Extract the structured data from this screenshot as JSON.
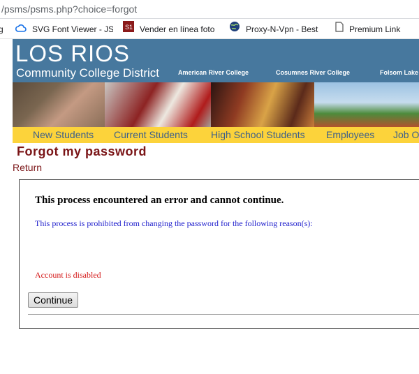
{
  "browser": {
    "url": "/psms/psms.php?choice=forgot",
    "bookmarks": [
      {
        "icon": "cloud-icon",
        "label": "SVG Font Viewer - JS"
      },
      {
        "icon": "st-logo-icon",
        "label": "Vender en línea foto"
      },
      {
        "icon": "globe-icon",
        "label": "Proxy-N-Vpn - Best"
      },
      {
        "icon": "page-icon",
        "label": "Premium Link"
      }
    ],
    "bookmark_prefix": "g"
  },
  "header": {
    "logo_line1": "LOS RIOS",
    "logo_line2": "Community College District",
    "colleges": [
      "American River College",
      "Cosumnes River College",
      "Folsom Lake"
    ]
  },
  "nav": {
    "items": [
      "New Students",
      "Current Students",
      "High School Students",
      "Employees",
      "Job O"
    ]
  },
  "page": {
    "title": "Forgot my password",
    "return_label": "Return"
  },
  "error": {
    "heading": "This process encountered an error and cannot continue.",
    "reason": "This process is prohibited from changing the password for the following reason(s):",
    "cause": "Account is disabled",
    "continue_label": "Continue"
  },
  "colors": {
    "banner": "#47789e",
    "nav": "#fcd33b",
    "title": "#7a1416",
    "reason": "#1d1dcc",
    "cause": "#d41818"
  }
}
